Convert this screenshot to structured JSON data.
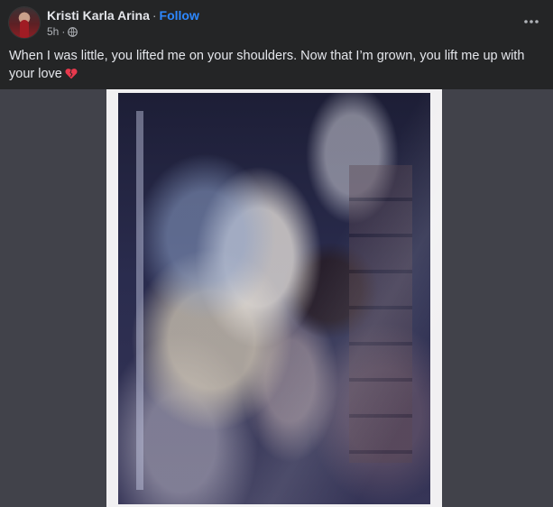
{
  "post": {
    "author_name": "Kristi Karla Arina",
    "separator": "·",
    "follow_label": "Follow",
    "timestamp": "5h",
    "audience_icon": "globe-icon",
    "more_icon": "more-options-icon",
    "caption": "When I was little, you lifted me on your shoulders. Now that I’m grown, you lift me up with your love",
    "caption_emoji_icon": "broken-heart-icon"
  },
  "colors": {
    "background": "#242526",
    "media_background": "#41424a",
    "primary_text": "#e4e6eb",
    "secondary_text": "#b0b3b8",
    "link": "#2d88ff",
    "emoji": "#e8394d"
  }
}
